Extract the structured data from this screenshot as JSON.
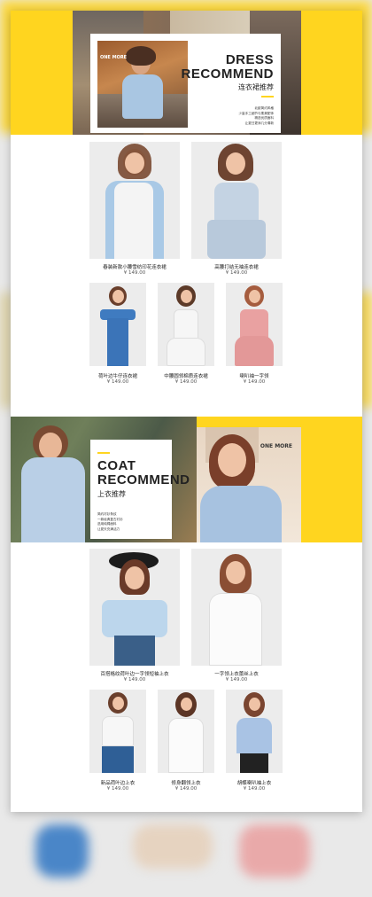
{
  "dress_section": {
    "title_line1": "DRESS",
    "title_line2": "RECOMMEND",
    "title_cn": "连衣裙推荐",
    "brand": "ONE MORE",
    "desc": [
      "北欧简约风格",
      "少量手工细节与柔美配饰",
      "精选优质面料",
      "让夏日更添几分清新"
    ]
  },
  "dress_products_large": [
    {
      "name": "春装新款小腰雪纺印花连衣裙",
      "price": "¥ 149.00"
    },
    {
      "name": "高腰打结无袖连衣裙",
      "price": "¥ 149.00"
    }
  ],
  "dress_products_small": [
    {
      "name": "荷叶边牛仔连衣裙",
      "price": "¥ 149.00"
    },
    {
      "name": "中腰圆领棉质连衣裙",
      "price": "¥ 149.00"
    },
    {
      "name": "喇叭袖一字领",
      "price": "¥ 149.00"
    }
  ],
  "coat_section": {
    "title_line1": "COAT",
    "title_line2": "RECOMMEND",
    "title_cn": "上衣推荐",
    "brand": "ONE MORE",
    "desc": [
      "简约衬衫条纹",
      "一款经典复古衬衫",
      "选用纯棉面料",
      "让夏天充满活力"
    ]
  },
  "coat_products_large": [
    {
      "name": "百搭格纹荷叶边一字领短袖上衣",
      "price": "¥ 149.00"
    },
    {
      "name": "一字领上衣蕾丝上衣",
      "price": "¥ 149.00"
    }
  ],
  "coat_products_small": [
    {
      "name": "新品荷叶边上衣",
      "price": "¥ 149.00"
    },
    {
      "name": "修身翻领上衣",
      "price": "¥ 149.00"
    },
    {
      "name": "胡蝶喇叭袖上衣",
      "price": "¥ 149.00"
    }
  ],
  "colors": {
    "accent": "#ffd51f",
    "background": "#ffffff",
    "frame": "#e9e9e9"
  }
}
